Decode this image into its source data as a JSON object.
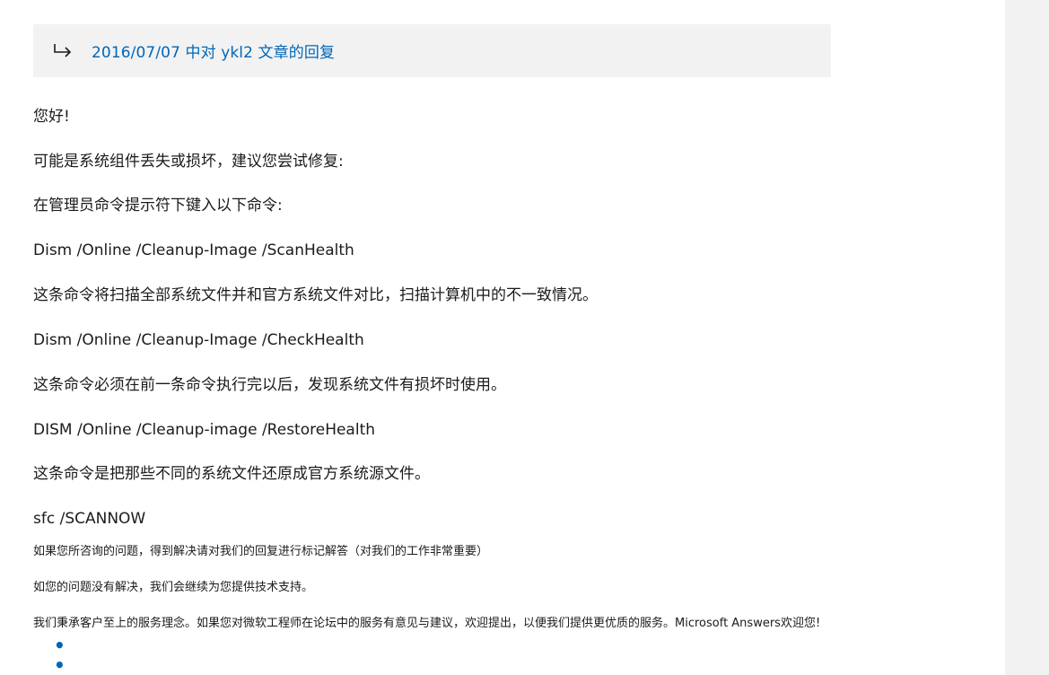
{
  "reply_banner": {
    "link_text": "2016/07/07 中对 ykl2 文章的回复",
    "icon": "reply-arrow-icon"
  },
  "post": {
    "greeting": "您好!",
    "line_cause": "可能是系统组件丢失或损坏，建议您尝试修复:",
    "line_instruction": "在管理员命令提示符下键入以下命令:",
    "cmd_scan": "Dism /Online /Cleanup-Image /ScanHealth",
    "desc_scan": "这条命令将扫描全部系统文件并和官方系统文件对比，扫描计算机中的不一致情况。",
    "cmd_check": "Dism /Online /Cleanup-Image /CheckHealth",
    "desc_check": "这条命令必须在前一条命令执行完以后，发现系统文件有损坏时使用。",
    "cmd_restore": "DISM /Online /Cleanup-image /RestoreHealth",
    "desc_restore": "这条命令是把那些不同的系统文件还原成官方系统源文件。",
    "cmd_sfc": "sfc /SCANNOW",
    "footer_mark": "如果您所咨询的问题，得到解决请对我们的回复进行标记解答（对我们的工作非常重要）",
    "footer_support": "如您的问题没有解决，我们会继续为您提供技术支持。",
    "footer_service": "我们秉承客户至上的服务理念。如果您对微软工程师在论坛中的服务有意见与建议，欢迎提出，以便我们提供更优质的服务。Microsoft Answers欢迎您!"
  },
  "more": {
    "label": "• • •",
    "icon": "more-dots-icon"
  },
  "colors": {
    "link": "#0067b8",
    "banner_bg": "#f2f2f2",
    "text": "#1b1b1b"
  }
}
